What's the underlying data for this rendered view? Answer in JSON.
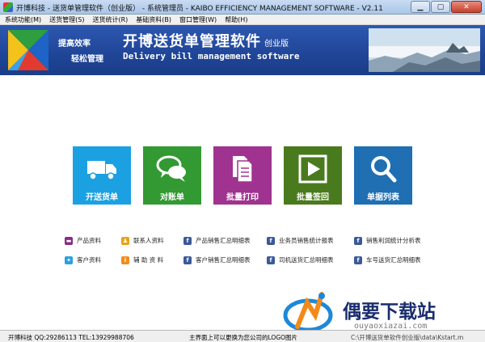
{
  "window": {
    "title": "开博科技 - 送货单管理软件（创业版） - 系统管理员 - KAIBO EFFICIENCY MANAGEMENT SOFTWARE - V2.11",
    "minimize_icon": "minimize-icon",
    "maximize_icon": "maximize-icon",
    "close_icon": "close-icon"
  },
  "menu": [
    {
      "label": "系统功能(M)"
    },
    {
      "label": "送货管理(S)"
    },
    {
      "label": "送货统计(R)"
    },
    {
      "label": "基础资料(B)"
    },
    {
      "label": "窗口管理(W)"
    },
    {
      "label": "帮助(H)"
    }
  ],
  "banner": {
    "slogan_line1": "提高效率",
    "slogan_line2": "轻松管理",
    "app_name": "开博送货单管理软件",
    "edition": "创业版",
    "app_name_en": "Delivery bill management software",
    "colors": {
      "banner": "#2450a8"
    }
  },
  "tiles": [
    {
      "label": "开送货单",
      "icon": "truck-icon",
      "color": "#1ba1e2"
    },
    {
      "label": "对账单",
      "icon": "chat-bubbles-icon",
      "color": "#339933"
    },
    {
      "label": "批量打印",
      "icon": "documents-icon",
      "color": "#a0338f"
    },
    {
      "label": "批量签回",
      "icon": "play-icon",
      "color": "#4a7a1e"
    },
    {
      "label": "单据列表",
      "icon": "magnifier-icon",
      "color": "#1f6fb2"
    }
  ],
  "links": [
    {
      "label": "产品资料",
      "icon": "product-icon",
      "color": "#8a2b8a",
      "glyph": "▬"
    },
    {
      "label": "联系人资料",
      "icon": "contact-icon",
      "color": "#e8a317",
      "glyph": "♟"
    },
    {
      "label": "产品销售汇总明细表",
      "icon": "facebook-icon",
      "color": "#3b5998",
      "glyph": "f"
    },
    {
      "label": "业务员销售统计报表",
      "icon": "facebook-icon",
      "color": "#3b5998",
      "glyph": "f"
    },
    {
      "label": "销售利润统计分析表",
      "icon": "facebook-icon",
      "color": "#3b5998",
      "glyph": "f"
    },
    {
      "label": "客户资料",
      "icon": "twitter-icon",
      "color": "#2aa0e0",
      "glyph": "✦"
    },
    {
      "label": "辅 助 资 料",
      "icon": "info-icon",
      "color": "#f08c1e",
      "glyph": "i"
    },
    {
      "label": "客户销售汇总明细表",
      "icon": "facebook-icon",
      "color": "#3b5998",
      "glyph": "f"
    },
    {
      "label": "司机送货汇总明细表",
      "icon": "facebook-icon",
      "color": "#3b5998",
      "glyph": "f"
    },
    {
      "label": "车号送货汇总明细表",
      "icon": "facebook-icon",
      "color": "#3b5998",
      "glyph": "f"
    }
  ],
  "watermark": {
    "text": "偶要下载站",
    "url": "ouyaoxiazai.com"
  },
  "status": {
    "left": "开博科技 QQ:29286113 TEL:13929988706",
    "middle": "主界面上可以更换为您公司的LOGO图片",
    "right": "C:\\开博送货单软件创业版\\data\\Kstart.m"
  }
}
